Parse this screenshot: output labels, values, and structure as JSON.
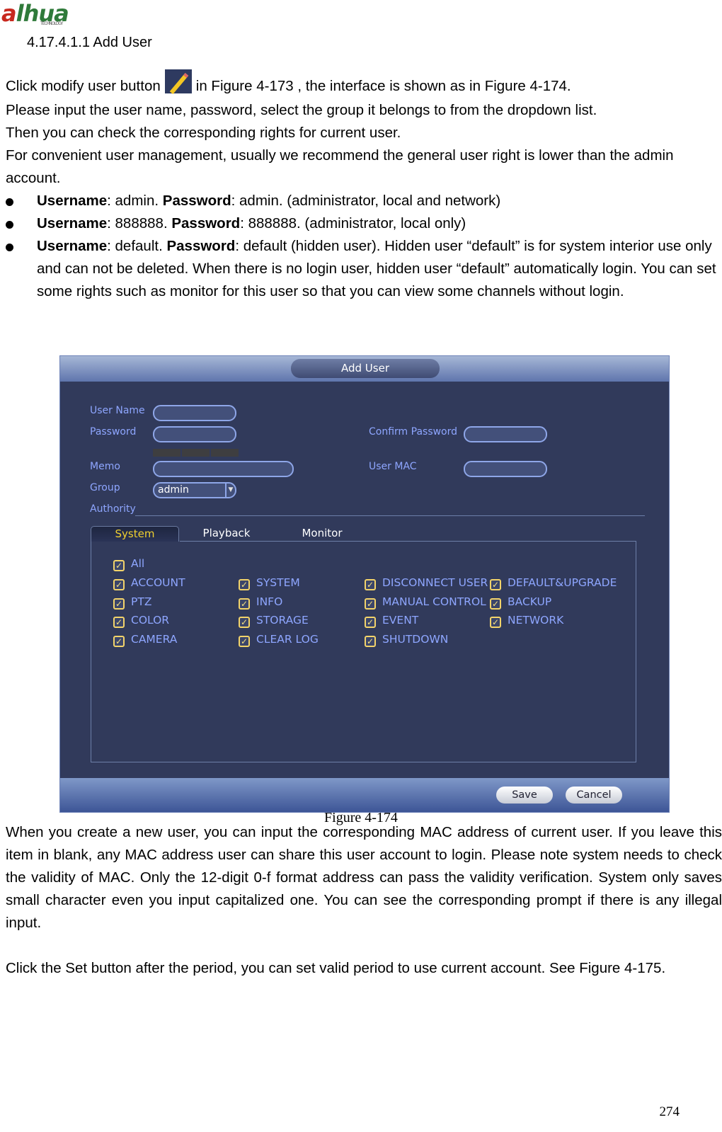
{
  "logo": {
    "text": "alhua",
    "tagline": "TECHNOLOGY"
  },
  "heading": "4.17.4.1.1  Add User",
  "intro": {
    "before": "Click modify user button",
    "icon": "pencil-icon",
    "after": "in Figure 4-173 , the interface is shown as in Figure 4-174."
  },
  "paragraphs": [
    "Please input the user name, password, select the group it belongs to from the dropdown list.",
    "Then you can check the corresponding rights for current user.",
    "For convenient user management, usually we recommend the general user right is lower than the admin account."
  ],
  "bullets": [
    {
      "k1": "Username",
      "v1": ": admin.    ",
      "k2": "Password",
      "v2": ": admin. (administrator, local and network)"
    },
    {
      "k1": "Username",
      "v1": ": 888888. ",
      "k2": "Password",
      "v2": ": 888888. (administrator, local only)"
    },
    {
      "k1": "Username",
      "v1": ": default. ",
      "k2": "Password",
      "v2": ": default (hidden user). Hidden user “default” is for system interior use only and can not be deleted. When there is no login user, hidden user “default” automatically login. You can set some rights such as monitor for this user so that you can view some channels without login."
    }
  ],
  "figure": {
    "title": "Add User",
    "labels": {
      "user_name": "User Name",
      "password": "Password",
      "confirm_password": "Confirm Password",
      "memo": "Memo",
      "user_mac": "User MAC",
      "group": "Group",
      "authority": "Authority"
    },
    "group_value": "admin",
    "tabs": [
      "System",
      "Playback",
      "Monitor"
    ],
    "active_tab": "System",
    "all": "All",
    "columns": [
      [
        "ACCOUNT",
        "PTZ",
        "COLOR",
        "CAMERA"
      ],
      [
        "SYSTEM",
        "INFO",
        "STORAGE",
        "CLEAR LOG"
      ],
      [
        "DISCONNECT USER",
        "MANUAL CONTROL",
        "EVENT",
        "SHUTDOWN"
      ],
      [
        "DEFAULT&UPGRADE",
        "BACKUP",
        "NETWORK"
      ]
    ],
    "checked": true,
    "save": "Save",
    "cancel": "Cancel",
    "colors": {
      "bg": "#313a5b",
      "label": "#8ea6ff",
      "active_tab": "#f0d030"
    }
  },
  "caption": "Figure 4-174",
  "after_paragraphs": [
    "When you create a new user, you can input the corresponding MAC address of current user. If you leave this item in blank, any MAC address user can share this user account to login. Please note system needs to check the validity of MAC. Only the 12-digit 0-f format address can pass the validity verification. System only saves small character even you input capitalized one. You can see the corresponding prompt if there is any illegal input.",
    "Click the Set button after the period, you can set valid period to use current account. See Figure 4-175."
  ],
  "page_number": "274"
}
